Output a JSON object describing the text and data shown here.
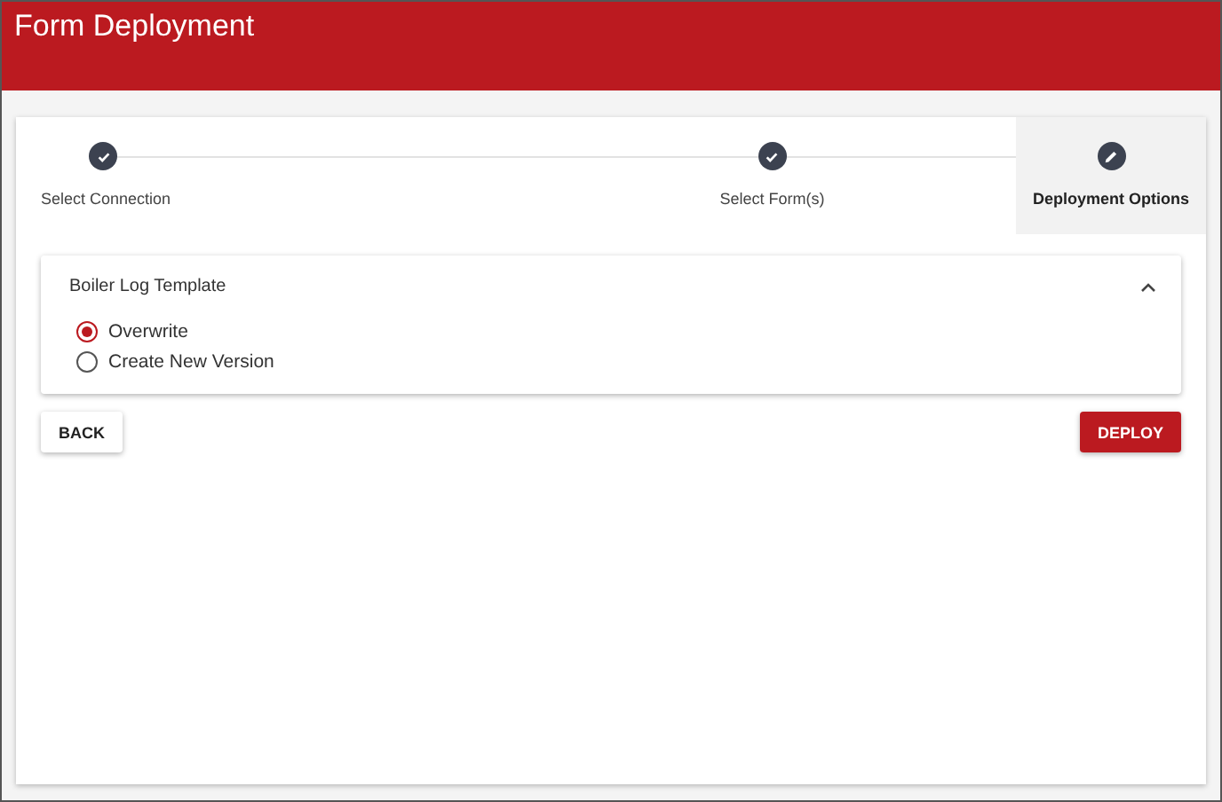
{
  "window": {
    "title": "Form Deployment"
  },
  "steps": [
    {
      "label": "Select Connection",
      "kind": "done",
      "selected": false
    },
    {
      "label": "Select Form(s)",
      "kind": "done",
      "selected": false
    },
    {
      "label": "Deployment Options",
      "kind": "edit",
      "selected": true
    }
  ],
  "panel": {
    "title": "Boiler Log Template",
    "expanded": true,
    "options": [
      {
        "label": "Overwrite",
        "selected": true
      },
      {
        "label": "Create New Version",
        "selected": false
      }
    ]
  },
  "buttons": [
    {
      "label": "BACK",
      "kind": "secondary"
    },
    {
      "label": "DEPLOY",
      "kind": "primary"
    }
  ]
}
